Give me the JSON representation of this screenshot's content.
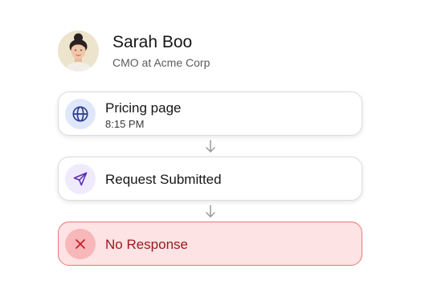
{
  "profile": {
    "name": "Sarah Boo",
    "role": "CMO at Acme Corp"
  },
  "steps": [
    {
      "title": "Pricing page",
      "subtitle": "8:15 PM",
      "icon": "globe-icon",
      "status": "info"
    },
    {
      "title": "Request Submitted",
      "icon": "send-icon",
      "status": "info"
    },
    {
      "title": "No Response",
      "icon": "close-icon",
      "status": "error"
    }
  ],
  "colors": {
    "globe_icon": "#2b3a8c",
    "send_icon": "#5a2db5",
    "error_icon": "#c6212b",
    "error_bg": "#fde3e3",
    "error_border": "#e9777b",
    "connector": "#9a9a9a"
  }
}
